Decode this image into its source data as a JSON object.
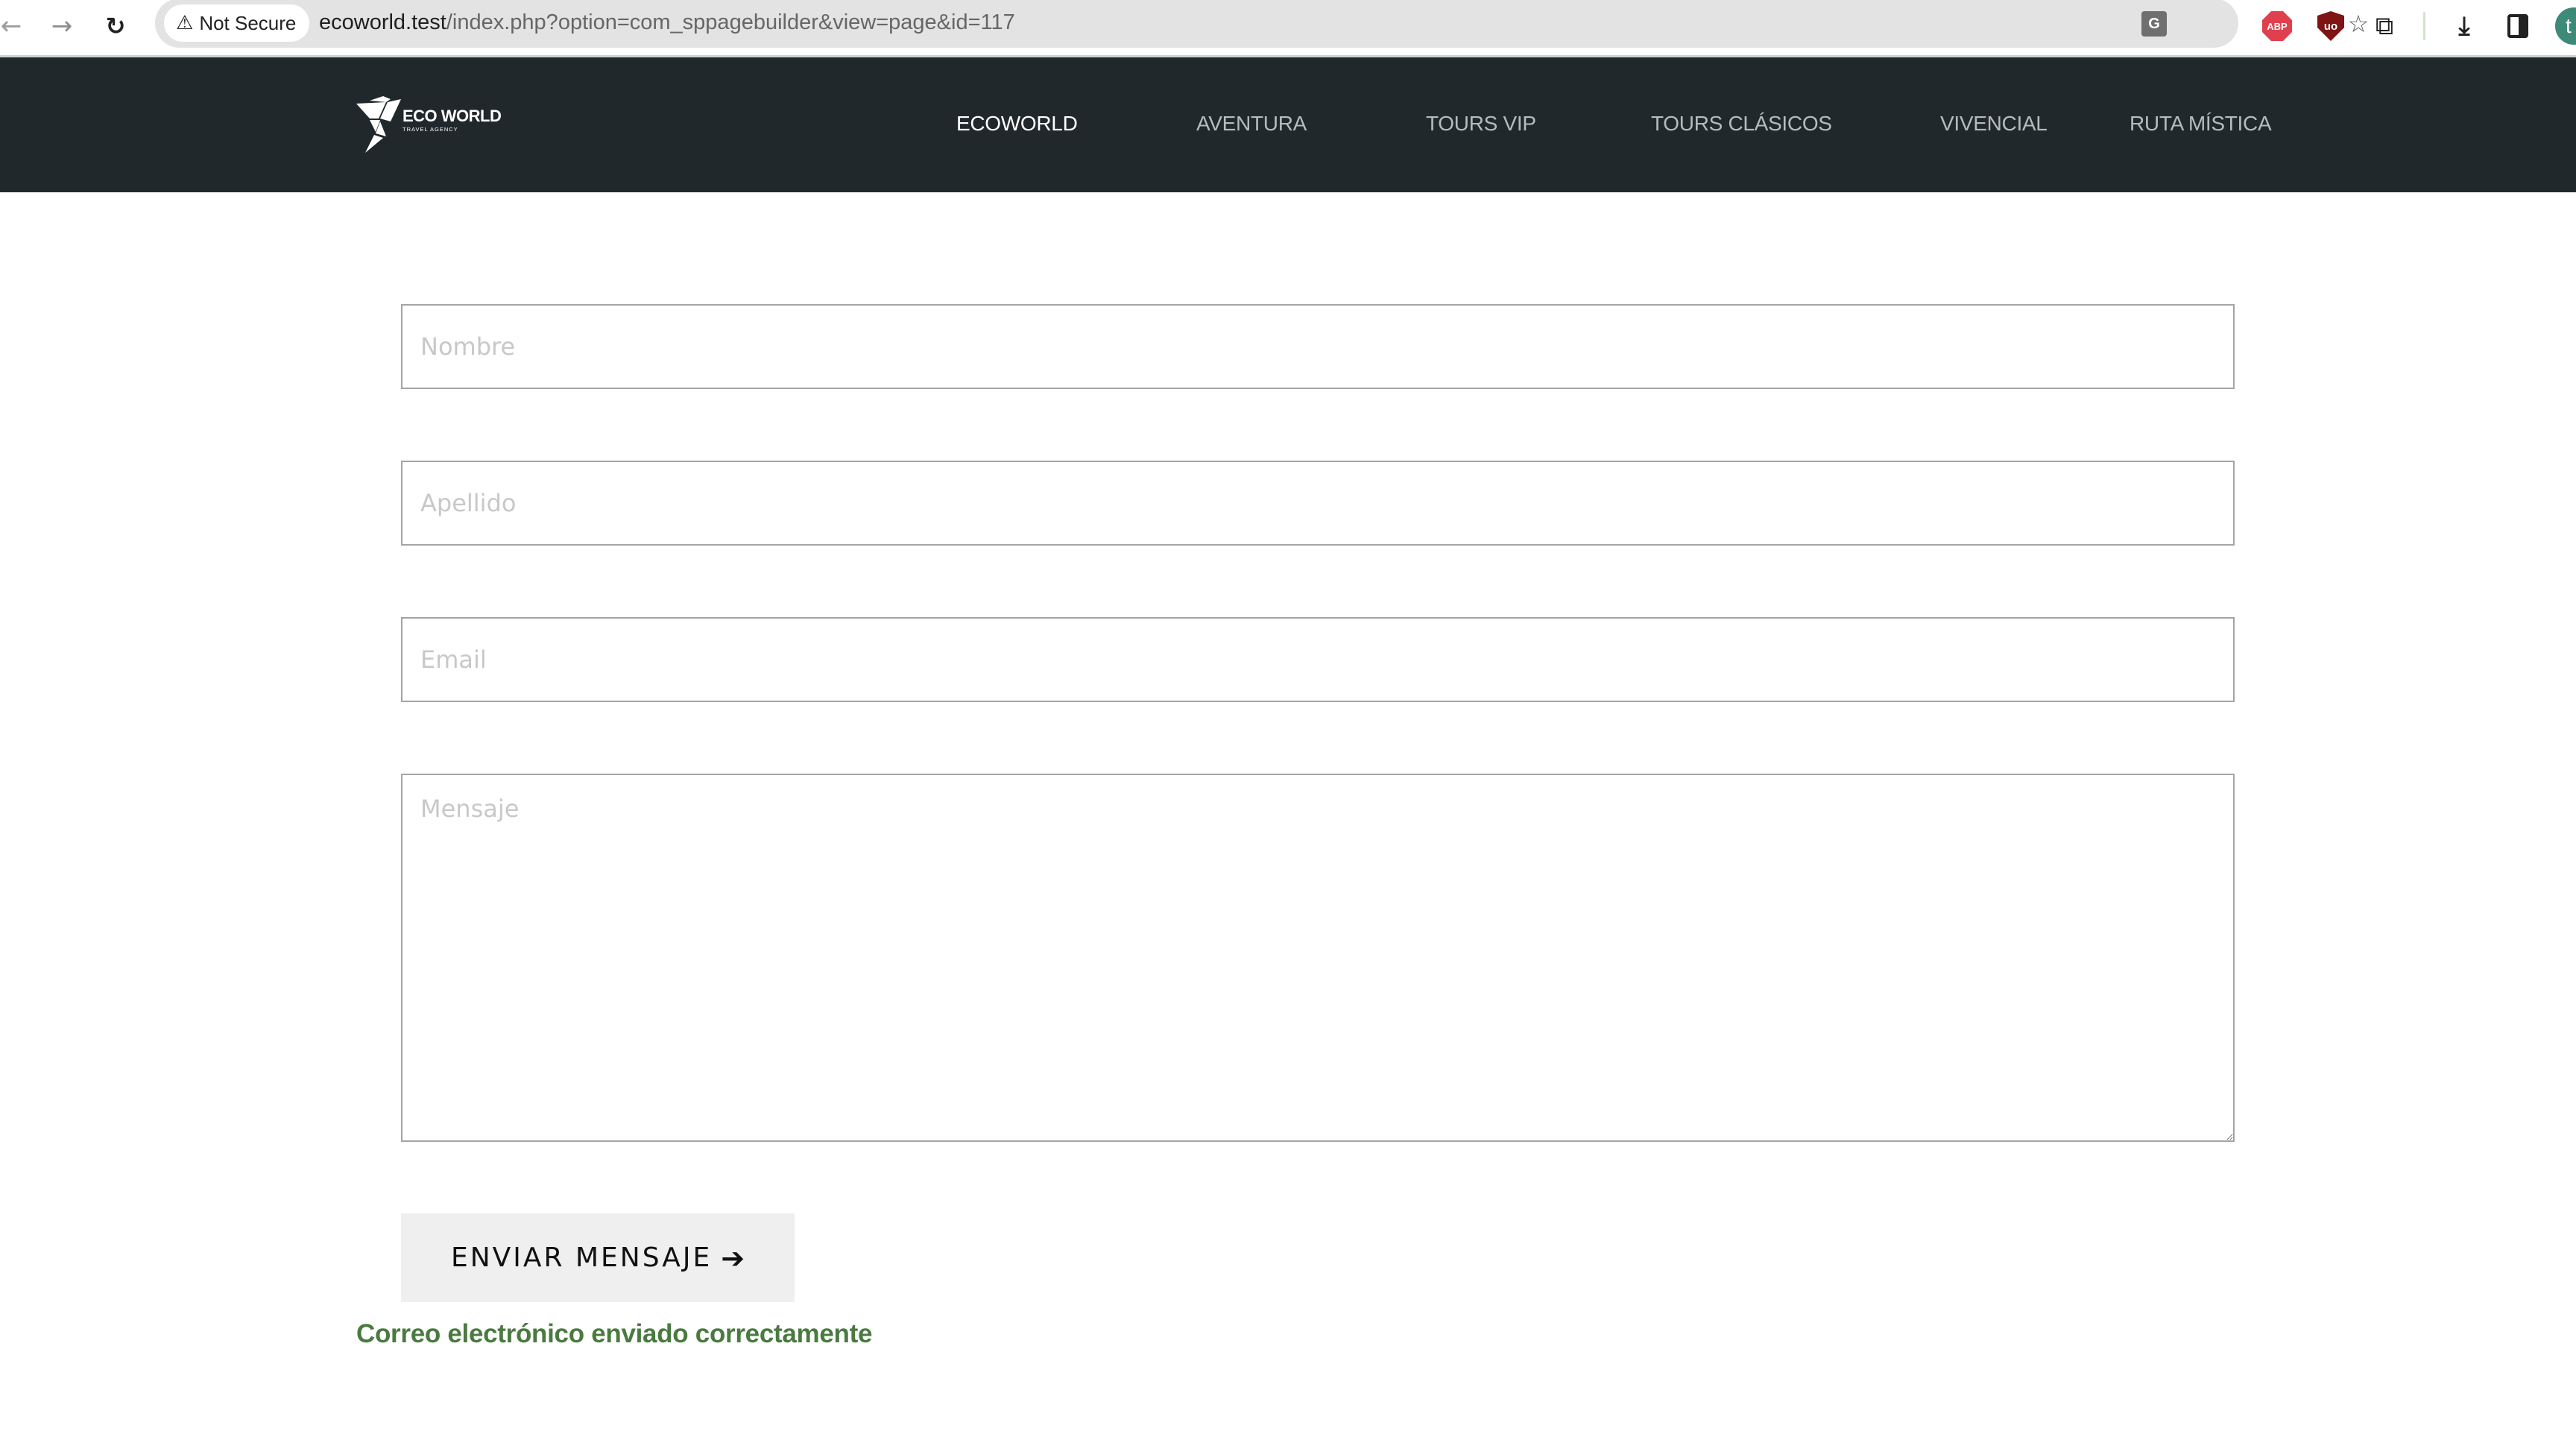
{
  "browser": {
    "security_label": "Not Secure",
    "url_host": "ecoworld.test",
    "url_path": "/index.php?option=com_sppagebuilder&view=page&id=117",
    "avatar_initial": "t",
    "icons": {
      "back": "←",
      "forward": "→",
      "reload": "↻",
      "warning": "⚠",
      "translate": "G",
      "bookmark": "☆",
      "abp": "ABP",
      "ublock": "uo",
      "extensions": "⧉",
      "download": "⤓"
    },
    "colors": {
      "avatar": "#3d8a78",
      "abp": "#e0404e",
      "ublock": "#7e1414"
    }
  },
  "site": {
    "logo": {
      "name": "ECO WORLD",
      "tagline": "TRAVEL AGENCY"
    },
    "menu": [
      {
        "label": "ECOWORLD",
        "active": true
      },
      {
        "label": "AVENTURA",
        "active": false
      },
      {
        "label": "TOURS VIP",
        "active": false
      },
      {
        "label": "TOURS CLÁSICOS",
        "active": false
      },
      {
        "label": "VIVENCIAL",
        "active": false
      },
      {
        "label": "RUTA MÍSTICA",
        "active": false
      }
    ],
    "colors": {
      "header_bg": "#21282b",
      "success": "#4a7a40"
    }
  },
  "form": {
    "nombre": {
      "placeholder": "Nombre",
      "value": ""
    },
    "apellido": {
      "placeholder": "Apellido",
      "value": ""
    },
    "email": {
      "placeholder": "Email",
      "value": ""
    },
    "mensaje": {
      "placeholder": "Mensaje",
      "value": ""
    },
    "submit_label": "ENVIAR MENSAJE",
    "submit_arrow": "➔",
    "success_message": "Correo electrónico enviado correctamente"
  }
}
